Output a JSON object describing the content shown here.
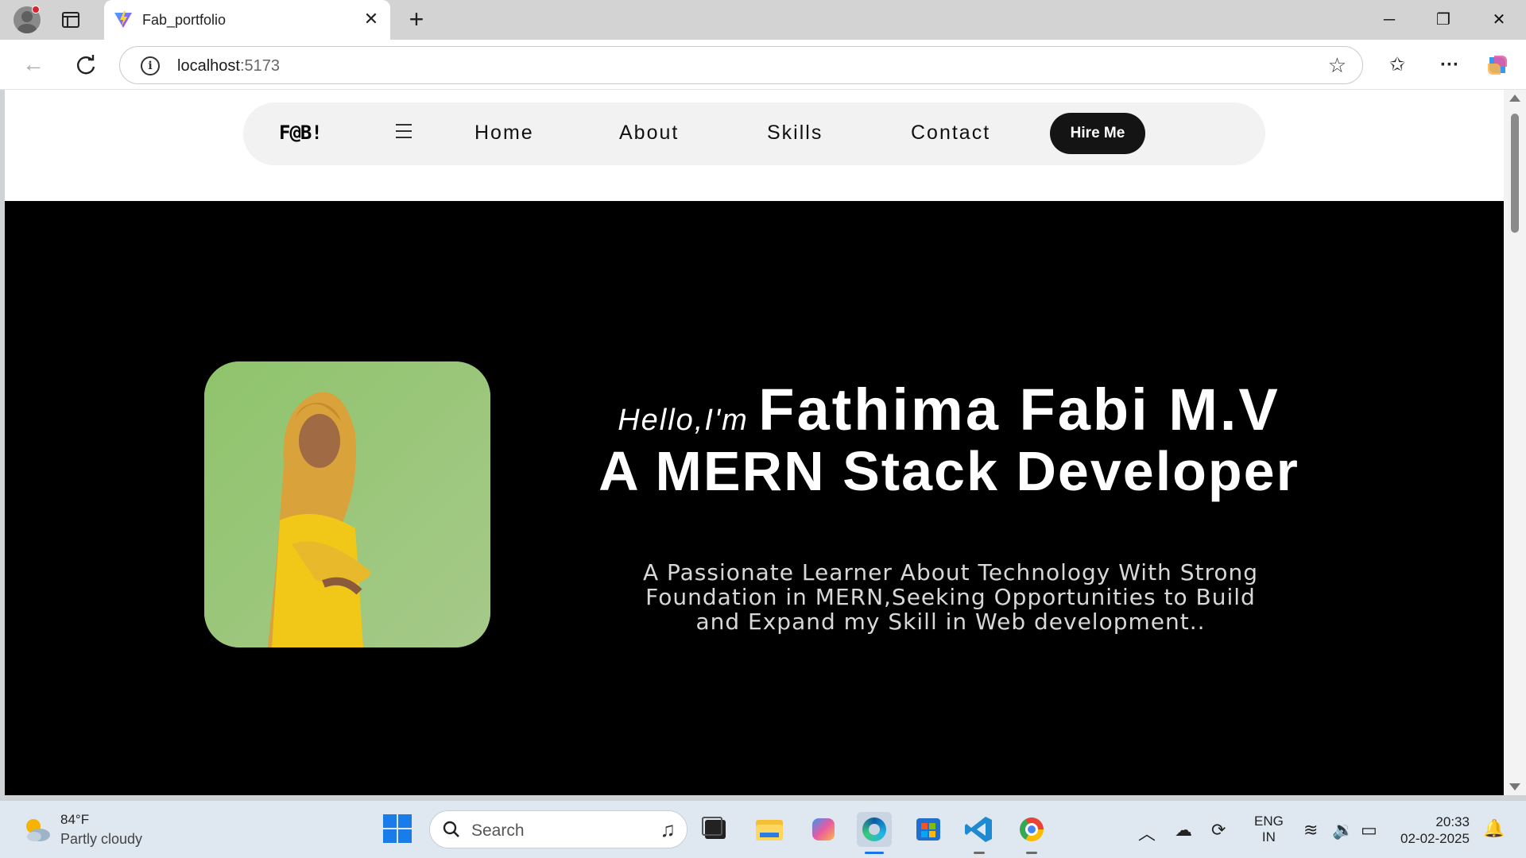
{
  "browser": {
    "tab_title": "Fab_portfolio",
    "tab_close": "✕",
    "new_tab": "+",
    "url_host": "localhost",
    "url_port": ":5173",
    "window_buttons": [
      "─",
      "❐",
      "✕"
    ]
  },
  "site": {
    "logo": "F@B!",
    "nav_links": [
      "Home",
      "About",
      "Skills",
      "Contact"
    ],
    "hire_button": "Hire Me",
    "hero": {
      "greeting": "Hello,I'm",
      "name": "Fathima Fabi M.V",
      "role": "A MERN Stack Developer",
      "description": "A Passionate Learner About Technology With Strong Foundation in MERN,Seeking Opportunities to Build and Expand my Skill in Web development.."
    }
  },
  "taskbar": {
    "weather_temp": "84°F",
    "weather_desc": "Partly cloudy",
    "search_label": "Search",
    "lang_top": "ENG",
    "lang_bottom": "IN",
    "time": "20:33",
    "date": "02-02-2025"
  },
  "colors": {
    "hero_bg": "#000000",
    "hire_button_bg": "#141414",
    "nav_pill_bg": "#f2f2f2",
    "photo_bg": "#95c277"
  }
}
